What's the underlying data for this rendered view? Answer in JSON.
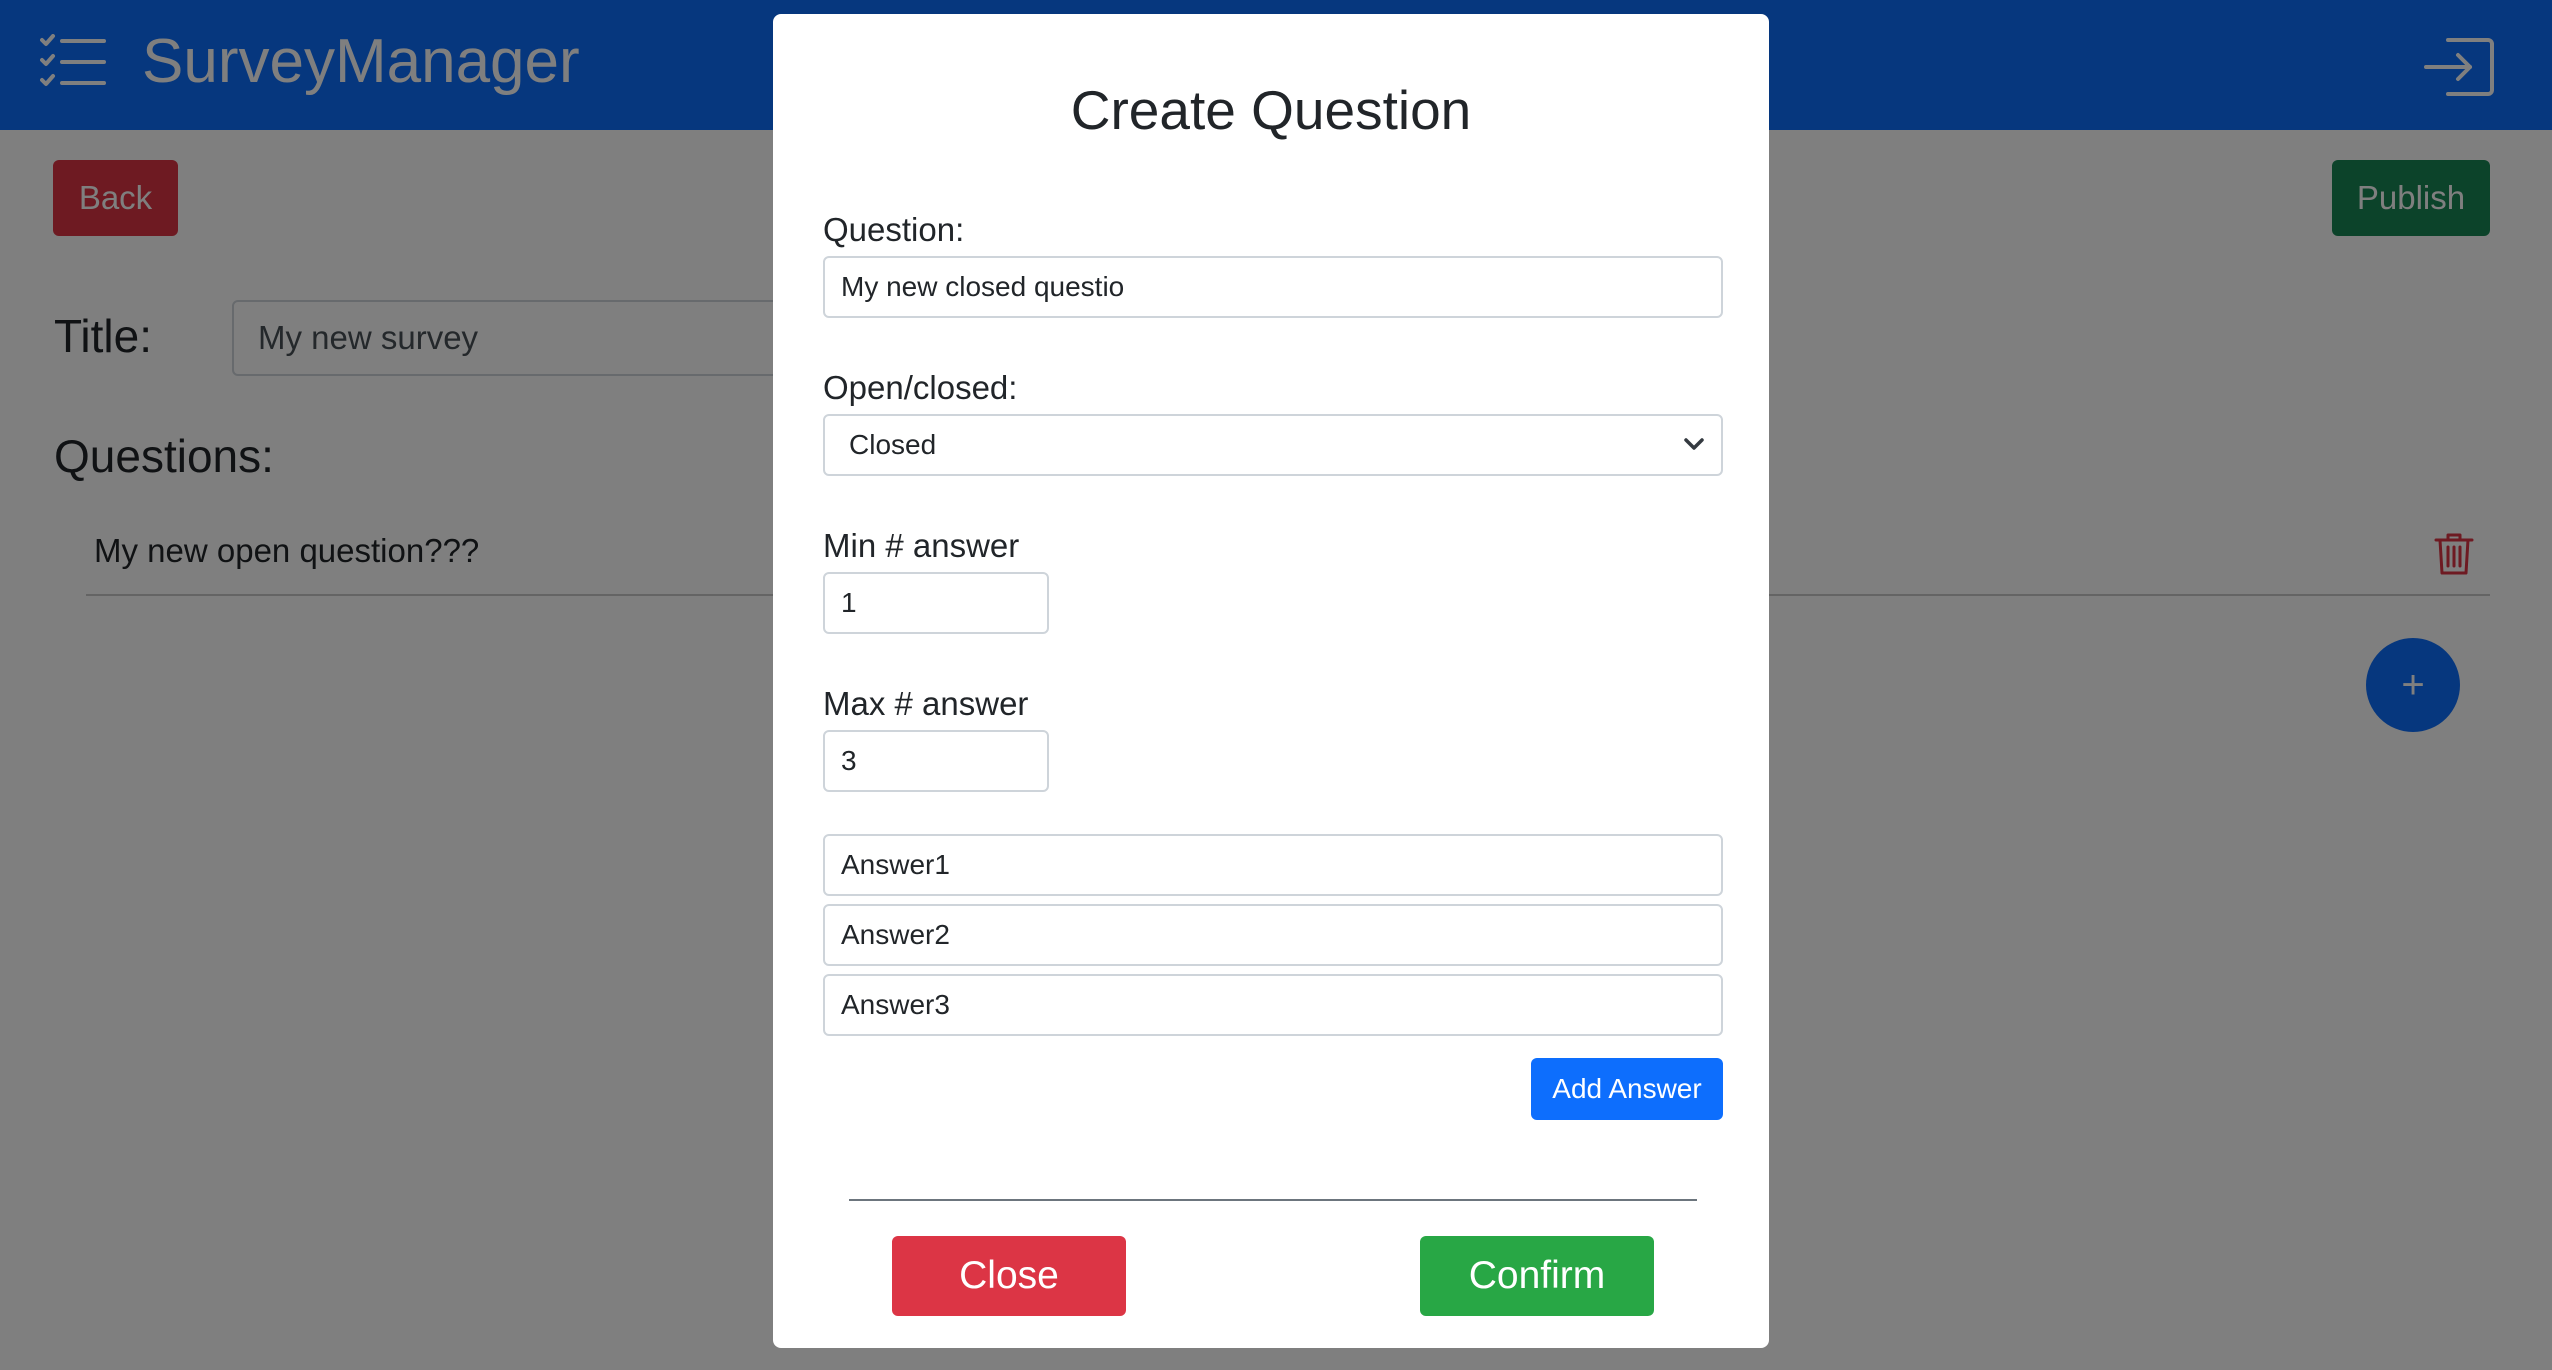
{
  "app": {
    "brand": "SurveyManager",
    "menu_icon": "checklist-icon",
    "login_icon": "login-icon"
  },
  "toolbar": {
    "back_label": "Back",
    "publish_label": "Publish"
  },
  "survey": {
    "title_label": "Title:",
    "title_value": "My new survey",
    "questions_heading": "Questions:",
    "questions": [
      {
        "text": "My new open question???",
        "delete_icon": "trash-icon"
      }
    ],
    "add_button_label": "+"
  },
  "modal": {
    "title": "Create Question",
    "question_label": "Question:",
    "question_value": "My new closed questio",
    "type_label": "Open/closed:",
    "type_selected": "Closed",
    "min_label": "Min # answer",
    "min_value": "1",
    "max_label": "Max # answer",
    "max_value": "3",
    "answers": [
      "Answer1",
      "Answer2",
      "Answer3"
    ],
    "add_answer_label": "Add Answer",
    "close_label": "Close",
    "confirm_label": "Confirm"
  },
  "colors": {
    "primary": "#0d6efd",
    "danger": "#dc3545",
    "success": "#198754",
    "confirm": "#28a745"
  }
}
